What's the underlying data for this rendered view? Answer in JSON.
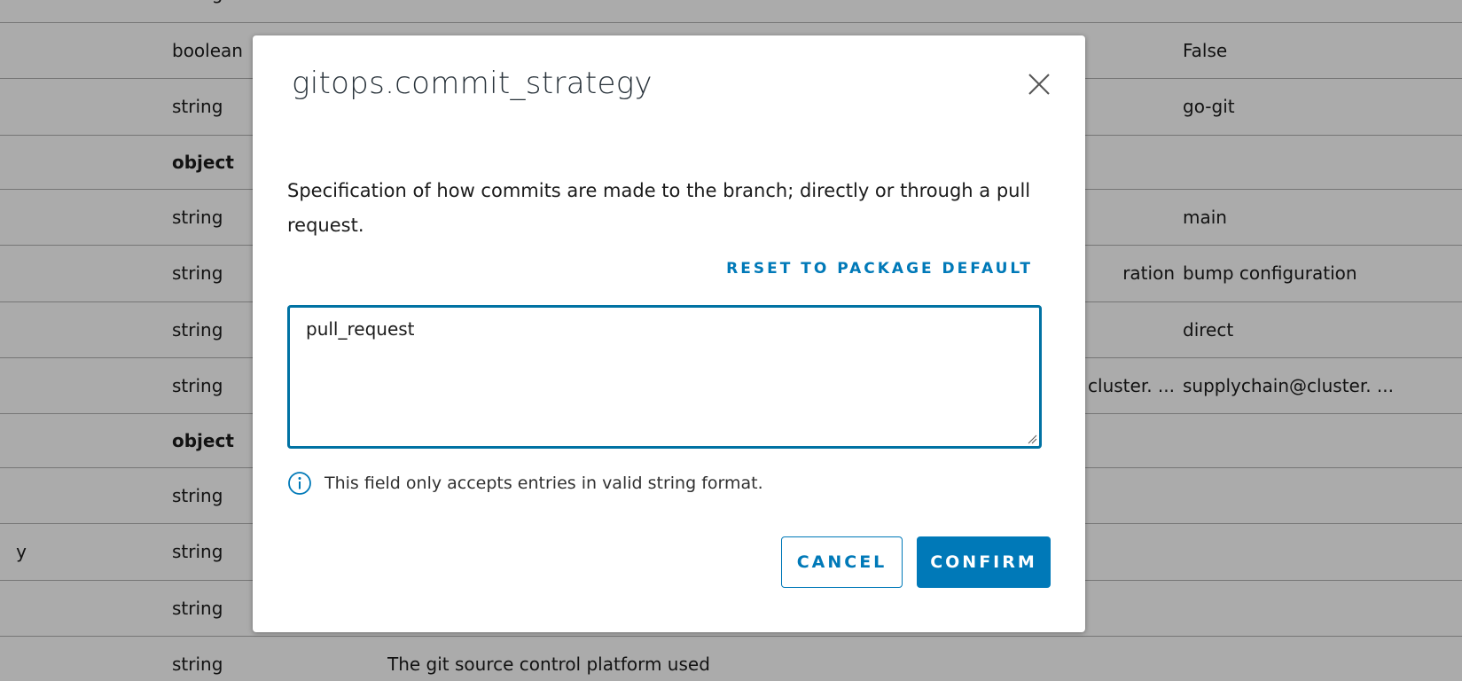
{
  "background_table": {
    "rows": [
      {
        "type": "string",
        "bold": false,
        "description": "",
        "default": "",
        "value": "",
        "partial_left": ""
      },
      {
        "type": "boolean",
        "bold": false,
        "description": "",
        "default": "",
        "value": "False",
        "partial_left": ""
      },
      {
        "type": "string",
        "bold": false,
        "description": "",
        "default": "",
        "value": "go-git",
        "partial_left": ""
      },
      {
        "type": "object",
        "bold": true,
        "description": "",
        "default": "",
        "value": "",
        "partial_left": ""
      },
      {
        "type": "string",
        "bold": false,
        "description": "",
        "default": "",
        "value": "main",
        "partial_left": ""
      },
      {
        "type": "string",
        "bold": false,
        "description": "",
        "default": "ration",
        "value": "bump configuration",
        "partial_left": ""
      },
      {
        "type": "string",
        "bold": false,
        "description": "",
        "default": "",
        "value": "direct",
        "partial_left": ""
      },
      {
        "type": "string",
        "bold": false,
        "description": "",
        "default": "cluster. ...",
        "value": "supplychain@cluster. ...",
        "partial_left": ""
      },
      {
        "type": "object",
        "bold": true,
        "description": "",
        "default": "",
        "value": "",
        "partial_left": ""
      },
      {
        "type": "string",
        "bold": false,
        "description": "",
        "default": "",
        "value": "",
        "partial_left": ""
      },
      {
        "type": "string",
        "bold": false,
        "description": "",
        "default": "",
        "value": "",
        "partial_left": "y"
      },
      {
        "type": "string",
        "bold": false,
        "description": "",
        "default": "",
        "value": "",
        "partial_left": ""
      },
      {
        "type": "string",
        "bold": false,
        "description": "The git source control platform used",
        "default": "",
        "value": "",
        "partial_left": ""
      }
    ]
  },
  "modal": {
    "title": "gitops.commit_strategy",
    "description": "Specification of how commits are made to the branch; directly or through a pull request.",
    "reset_label": "RESET TO PACKAGE DEFAULT",
    "input_value": "pull_request",
    "helper_text": "This field only accepts entries in valid string format.",
    "cancel_label": "CANCEL",
    "confirm_label": "CONFIRM"
  },
  "icons": {
    "close": "close-icon",
    "info": "info-icon",
    "resize": "resize-handle-icon"
  },
  "colors": {
    "accent": "#0079b8",
    "input_border": "#0072a3",
    "overlay": "rgba(0,0,0,0.33)"
  }
}
